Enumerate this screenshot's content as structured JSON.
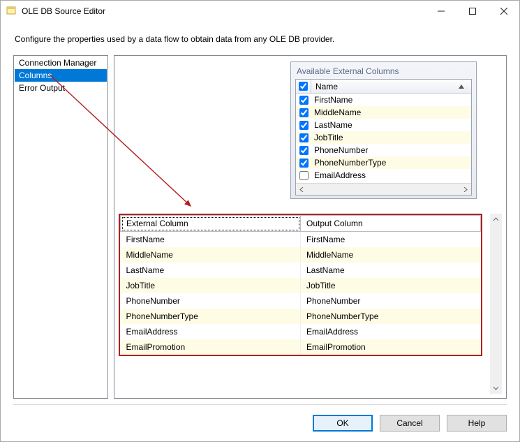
{
  "window": {
    "title": "OLE DB Source Editor",
    "description": "Configure the properties used by a data flow to obtain data from any OLE DB provider."
  },
  "nav": {
    "items": [
      {
        "label": "Connection Manager",
        "selected": false
      },
      {
        "label": "Columns",
        "selected": true
      },
      {
        "label": "Error Output",
        "selected": false
      }
    ]
  },
  "available": {
    "title": "Available External Columns",
    "name_header": "Name",
    "columns": [
      {
        "label": "FirstName",
        "checked": true,
        "alt": false
      },
      {
        "label": "MiddleName",
        "checked": true,
        "alt": true
      },
      {
        "label": "LastName",
        "checked": true,
        "alt": false
      },
      {
        "label": "JobTitle",
        "checked": true,
        "alt": true
      },
      {
        "label": "PhoneNumber",
        "checked": true,
        "alt": false
      },
      {
        "label": "PhoneNumberType",
        "checked": true,
        "alt": true
      },
      {
        "label": "EmailAddress",
        "checked": false,
        "alt": false
      }
    ]
  },
  "grid": {
    "headers": {
      "external": "External Column",
      "output": "Output Column"
    },
    "rows": [
      {
        "external": "FirstName",
        "output": "FirstName",
        "alt": false
      },
      {
        "external": "MiddleName",
        "output": "MiddleName",
        "alt": true
      },
      {
        "external": "LastName",
        "output": "LastName",
        "alt": false
      },
      {
        "external": "JobTitle",
        "output": "JobTitle",
        "alt": true
      },
      {
        "external": "PhoneNumber",
        "output": "PhoneNumber",
        "alt": false
      },
      {
        "external": "PhoneNumberType",
        "output": "PhoneNumberType",
        "alt": true
      },
      {
        "external": "EmailAddress",
        "output": "EmailAddress",
        "alt": false
      },
      {
        "external": "EmailPromotion",
        "output": "EmailPromotion",
        "alt": true
      }
    ]
  },
  "buttons": {
    "ok": "OK",
    "cancel": "Cancel",
    "help": "Help"
  }
}
